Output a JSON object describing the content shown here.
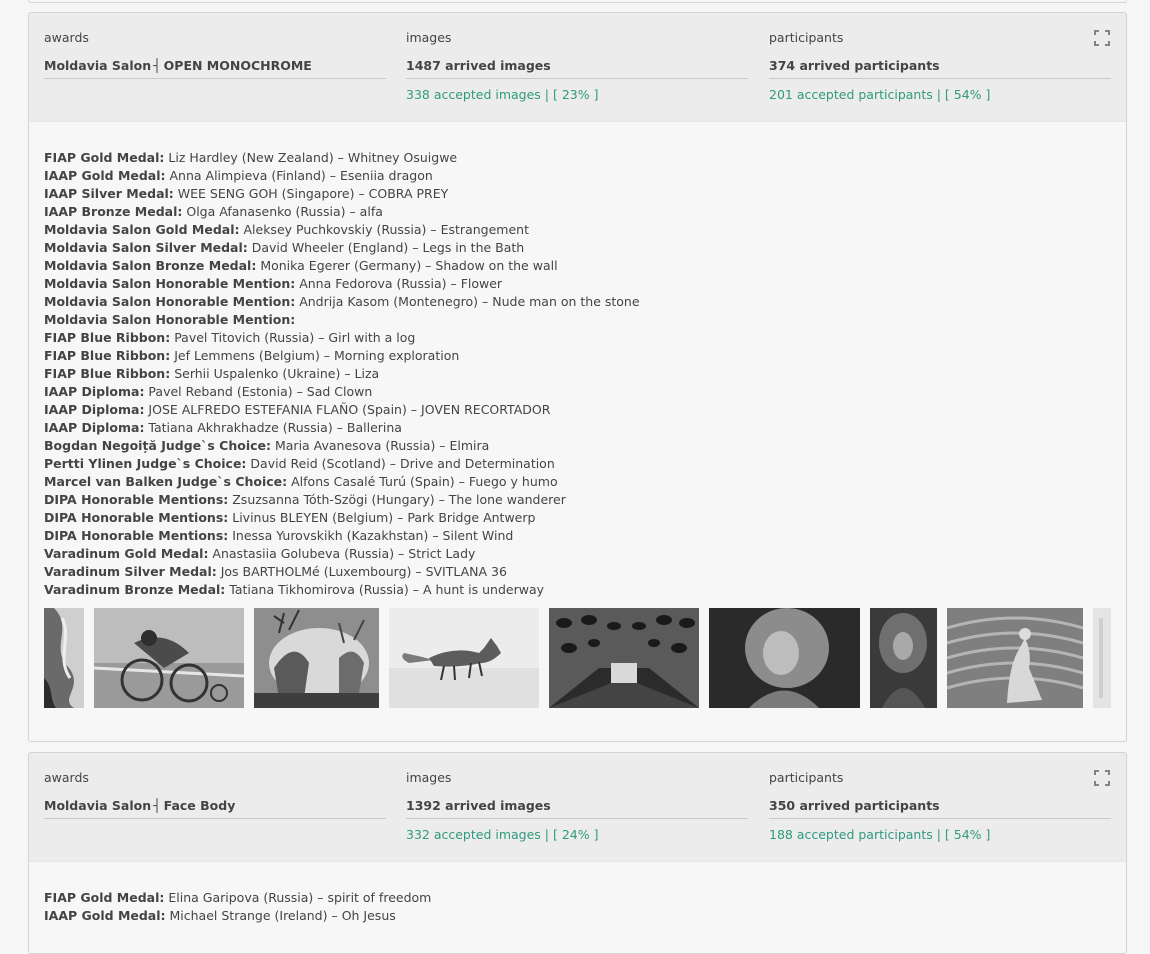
{
  "cards": [
    {
      "awards_label": "awards",
      "salon": "Moldavia Salon",
      "separator": "┤",
      "section": "OPEN MONOCHROME",
      "images_label": "images",
      "arrived_images": "1487 arrived images",
      "accepted_images": "338 accepted images | [ 23% ]",
      "participants_label": "participants",
      "arrived_participants": "374 arrived participants",
      "accepted_participants": "201 accepted participants | [ 54% ]",
      "awards": [
        {
          "title": "FIAP Gold Medal:",
          "text": " Liz Hardley (New Zealand) – Whitney Osuigwe"
        },
        {
          "title": "IAAP Gold Medal:",
          "text": " Anna Alimpieva (Finland) – Eseniia dragon"
        },
        {
          "title": "IAAP Silver Medal:",
          "text": " WEE SENG GOH (Singapore) – COBRA PREY"
        },
        {
          "title": "IAAP Bronze Medal:",
          "text": " Olga Afanasenko (Russia) –  alfa"
        },
        {
          "title": "Moldavia Salon Gold Medal:",
          "text": " Aleksey Puchkovskiy (Russia) – Estrangement"
        },
        {
          "title": "Moldavia Salon Silver Medal:",
          "text": " David Wheeler (England) – Legs in the Bath"
        },
        {
          "title": "Moldavia Salon Bronze Medal:",
          "text": " Monika Egerer (Germany) – Shadow on the wall"
        },
        {
          "title": "Moldavia Salon Honorable Mention:",
          "text": " Anna Fedorova (Russia) – Flower"
        },
        {
          "title": "Moldavia Salon Honorable Mention:",
          "text": " Andrija Kasom (Montenegro) – Nude man on the stone"
        },
        {
          "title": "Moldavia Salon Honorable Mention:",
          "text": ""
        },
        {
          "title": "FIAP Blue Ribbon:",
          "text": " Pavel Titovich (Russia) – Girl with a log"
        },
        {
          "title": "FIAP Blue Ribbon:",
          "text": " Jef Lemmens (Belgium) – Morning exploration"
        },
        {
          "title": "FIAP Blue Ribbon:",
          "text": " Serhii Uspalenko (Ukraine) – Liza"
        },
        {
          "title": "IAAP Diploma:",
          "text": " Pavel Reband (Estonia) – Sad Clown"
        },
        {
          "title": "IAAP Diploma:",
          "text": " JOSE ALFREDO ESTEFANIA FLAÑO (Spain) – JOVEN RECORTADOR"
        },
        {
          "title": "IAAP Diploma:",
          "text": " Tatiana Akhrakhadze (Russia) – Ballerina"
        },
        {
          "title": "Bogdan Negoiță Judge`s Choice:",
          "text": " Maria Avanesova (Russia) – Elmira"
        },
        {
          "title": "Pertti Ylinen Judge`s Choice:",
          "text": " David Reid (Scotland) – Drive and Determination"
        },
        {
          "title": "Marcel van Balken Judge`s Choice:",
          "text": " Alfons Casalé Turú (Spain) – Fuego y humo"
        },
        {
          "title": "DIPA Honorable Mentions:",
          "text": " Zsuzsanna Tóth-Szögi (Hungary) – The lone wanderer"
        },
        {
          "title": "DIPA Honorable Mentions:",
          "text": " Livinus BLEYEN (Belgium) – Park Bridge Antwerp"
        },
        {
          "title": "DIPA Honorable Mentions:",
          "text": " Inessa Yurovskikh (Kazakhstan) – Silent Wind"
        },
        {
          "title": "Varadinum Gold Medal:",
          "text": " Anastasiia Golubeva (Russia) – Strict Lady"
        },
        {
          "title": "Varadinum Silver Medal:",
          "text": " Jos BARTHOLMé (Luxembourg) – SVITLANA 36"
        },
        {
          "title": "Varadinum Bronze Medal:",
          "text": " Tatiana Tikhomirova (Russia) – A hunt is underway"
        }
      ]
    },
    {
      "awards_label": "awards",
      "salon": "Moldavia Salon",
      "separator": "┤",
      "section": "Face Body",
      "images_label": "images",
      "arrived_images": "1392 arrived images",
      "accepted_images": "332 accepted images | [ 24% ]",
      "participants_label": "participants",
      "arrived_participants": "350 arrived participants",
      "accepted_participants": "188 accepted participants | [ 54% ]",
      "awards": [
        {
          "title": "FIAP Gold Medal:",
          "text": " Elina Garipova (Russia) – spirit of freedom"
        },
        {
          "title": "IAAP Gold Medal:",
          "text": " Michael Strange (Ireland) – Oh Jesus"
        }
      ]
    }
  ],
  "colors": {
    "accent": "#2f9a7c",
    "header_bg": "#ececec",
    "card_bg": "#f7f7f7"
  }
}
